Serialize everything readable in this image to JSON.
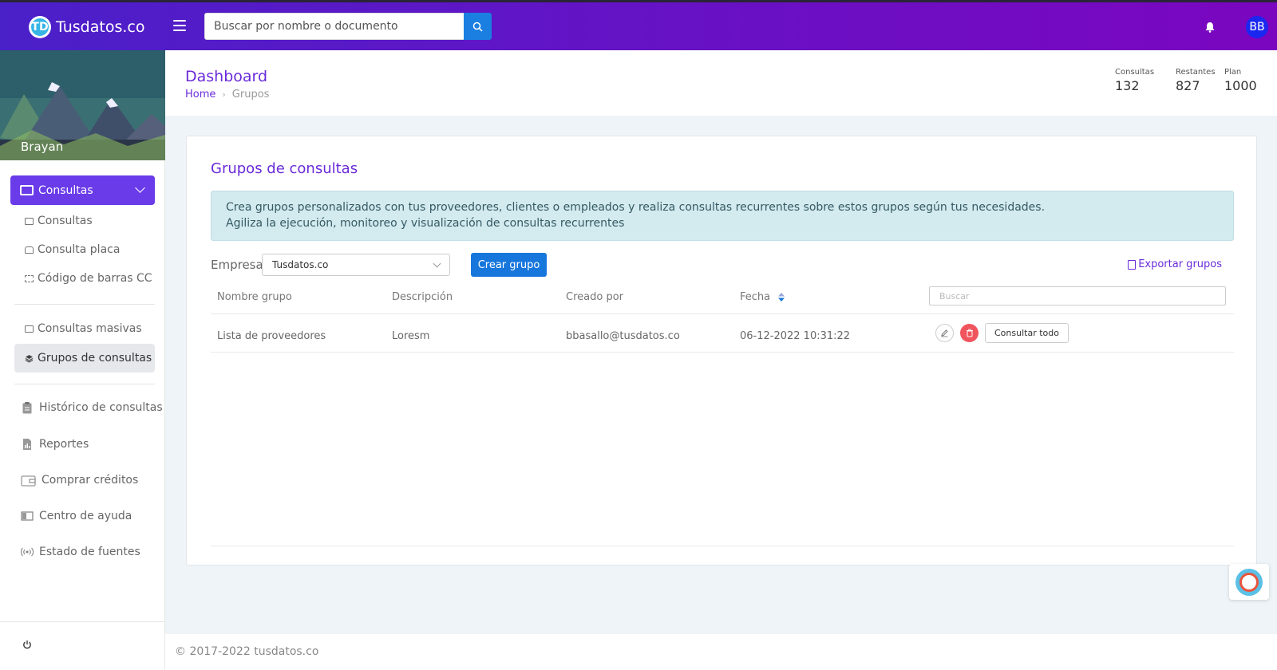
{
  "header": {
    "brand": "Tusdatos.co",
    "logo_glyph": "TD",
    "search_placeholder": "Buscar por nombre o documento",
    "avatar_initials": "BB"
  },
  "sidebar": {
    "user_name": "Brayan",
    "active_section": "Consultas",
    "sub_items_1": [
      "Consultas",
      "Consulta placa",
      "Código de barras CC"
    ],
    "sub_items_2": [
      "Consultas masivas",
      "Grupos de consultas"
    ],
    "main_items": [
      "Histórico de consultas",
      "Reportes",
      "Comprar créditos",
      "Centro de ayuda",
      "Estado de fuentes"
    ]
  },
  "page": {
    "title": "Dashboard",
    "breadcrumb_home": "Home",
    "breadcrumb_current": "Grupos",
    "stats": [
      {
        "label": "Consultas",
        "value": "132"
      },
      {
        "label": "Restantes",
        "value": "827"
      },
      {
        "label": "Plan",
        "value": "1000"
      }
    ]
  },
  "card": {
    "title": "Grupos de consultas",
    "info_line1": "Crea grupos personalizados con tus proveedores, clientes o empleados y realiza consultas recurrentes sobre estos grupos según tus necesidades.",
    "info_line2": "Agiliza la ejecución, monitoreo y visualización de consultas recurrentes",
    "empresa_label": "Empresa",
    "empresa_value": "Tusdatos.co",
    "create_button": "Crear grupo",
    "export_link": "Exportar grupos",
    "table": {
      "headers": [
        "Nombre grupo",
        "Descripción",
        "Creado por",
        "Fecha"
      ],
      "search_placeholder": "Buscar",
      "rows": [
        {
          "name": "Lista de proveedores",
          "description": "Loresm",
          "created_by": "bbasallo@tusdatos.co",
          "date": "06-12-2022 10:31:22",
          "action": "Consultar todo"
        }
      ]
    }
  },
  "footer": {
    "copyright": "© 2017-2022 tusdatos.co"
  },
  "colors": {
    "brand_purple": "#6a2bd9",
    "primary_blue": "#1776dc",
    "danger": "#f0545c"
  }
}
